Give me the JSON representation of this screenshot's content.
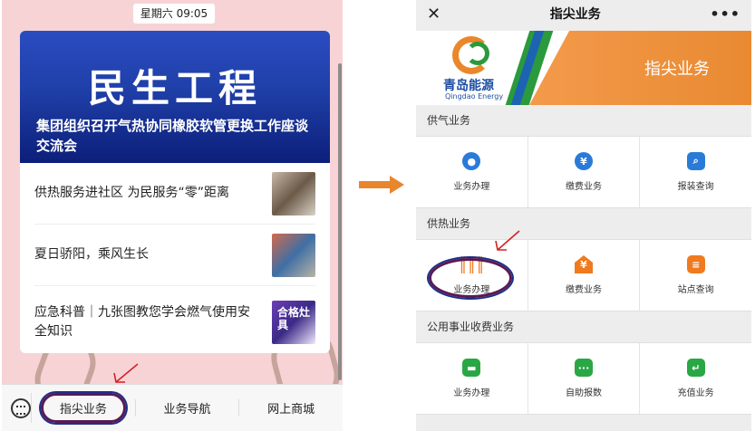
{
  "left_phone": {
    "status_time": "星期六 09:05",
    "banner": {
      "title": "民生工程",
      "headline": "集团组织召开气热协同橡胶软管更换工作座谈交流会"
    },
    "news": [
      {
        "text": "供热服务进社区 为民服务“零”距离"
      },
      {
        "text": "夏日骄阳，乘风生长"
      },
      {
        "text": "应急科普｜九张图教您学会燃气使用安全知识",
        "thumb_text": "合格灶具"
      }
    ],
    "bottom_bar": {
      "items": [
        "指尖业务",
        "业务导航",
        "网上商城"
      ]
    }
  },
  "right_phone": {
    "header": {
      "close": "✕",
      "title": "指尖业务",
      "more": "•••"
    },
    "banner": {
      "logo_cn": "青岛能源",
      "logo_en": "Qingdao Energy",
      "label": "指尖业务"
    },
    "sections": [
      {
        "title": "供气业务",
        "items": [
          {
            "icon": "flame-icon",
            "glyph": "🔥",
            "label": "业务办理"
          },
          {
            "icon": "yuan-icon",
            "glyph": "¥",
            "label": "缴费业务"
          },
          {
            "icon": "search-icon",
            "glyph": "⌕",
            "label": "报装查询"
          }
        ]
      },
      {
        "title": "供热业务",
        "items": [
          {
            "icon": "radiator-icon",
            "glyph": "║║║",
            "label": "业务办理"
          },
          {
            "icon": "house-yuan-icon",
            "glyph": "¥",
            "label": "缴费业务"
          },
          {
            "icon": "station-search-icon",
            "glyph": "≡",
            "label": "站点查询"
          }
        ]
      },
      {
        "title": "公用事业收费业务",
        "items": [
          {
            "icon": "briefcase-icon",
            "glyph": "▬",
            "label": "业务办理"
          },
          {
            "icon": "message-icon",
            "glyph": "···",
            "label": "自助报数"
          },
          {
            "icon": "recharge-icon",
            "glyph": "↵",
            "label": "充值业务"
          }
        ]
      }
    ]
  },
  "colors": {
    "left_bg": "#f7d3d6",
    "banner_blue": "#1f3fa8",
    "highlight_ring": "#5a1a52",
    "brand_orange": "#f07a1e",
    "brand_green": "#29a745",
    "brand_blue": "#2a7bd8",
    "arrow_orange": "#e8862e",
    "annotation_red": "#d22222"
  }
}
